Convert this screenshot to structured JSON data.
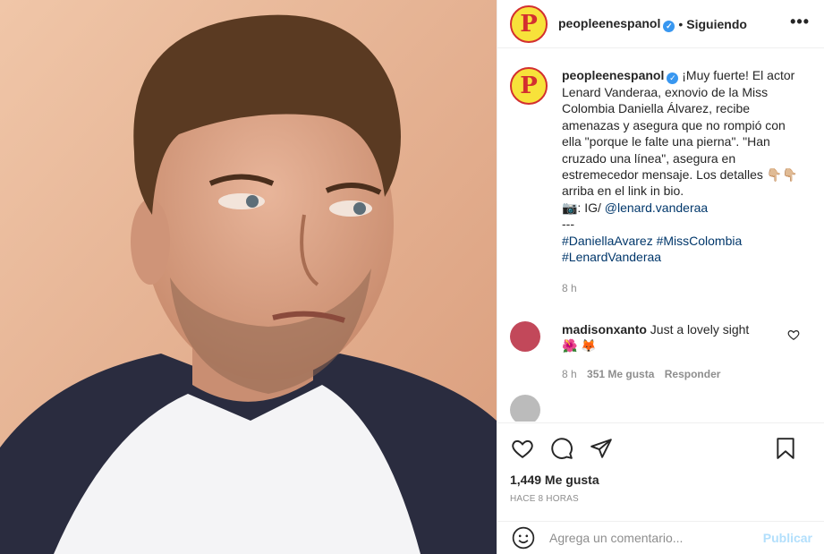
{
  "header": {
    "username": "peopleenespanol",
    "separator": "•",
    "follow_status": "Siguiendo",
    "more": "•••"
  },
  "caption": {
    "username": "peopleenespanol",
    "text1": "¡Muy fuerte! El actor Lenard Vanderaa, exnovio de la Miss Colombia Daniella Álvarez, recibe amenazas y asegura que no rompió con ella \"porque le falte una pierna\". \"Han cruzado una línea\", asegura en estremecedor mensaje. Los detalles 👇🏼👇🏼 arriba en el link in bio.",
    "camera": "📷: IG/ ",
    "mention": "@lenard.vanderaa",
    "dashes": "---",
    "hashtags_line1": "#DaniellaAvarez #MissColombia",
    "hashtags_line2": "#LenardVanderaa",
    "time": "8 h"
  },
  "comment": {
    "username": "madisonxanto",
    "text": "Just a lovely sight",
    "emojis": "🌺 🦊",
    "time": "8 h",
    "likes": "351 Me gusta",
    "reply": "Responder"
  },
  "next_comment": {
    "text": "...  ...  ..."
  },
  "actions": {
    "icons": [
      "heart-icon",
      "comment-icon",
      "share-icon",
      "bookmark-icon"
    ],
    "likes": "1,449 Me gusta",
    "time": "HACE 8 HORAS"
  },
  "composer": {
    "placeholder": "Agrega un comentario...",
    "publish": "Publicar"
  },
  "colors": {
    "link": "#00376b",
    "muted": "#8e8e8e",
    "verified": "#3897f0",
    "publish": "#b2dffc"
  }
}
